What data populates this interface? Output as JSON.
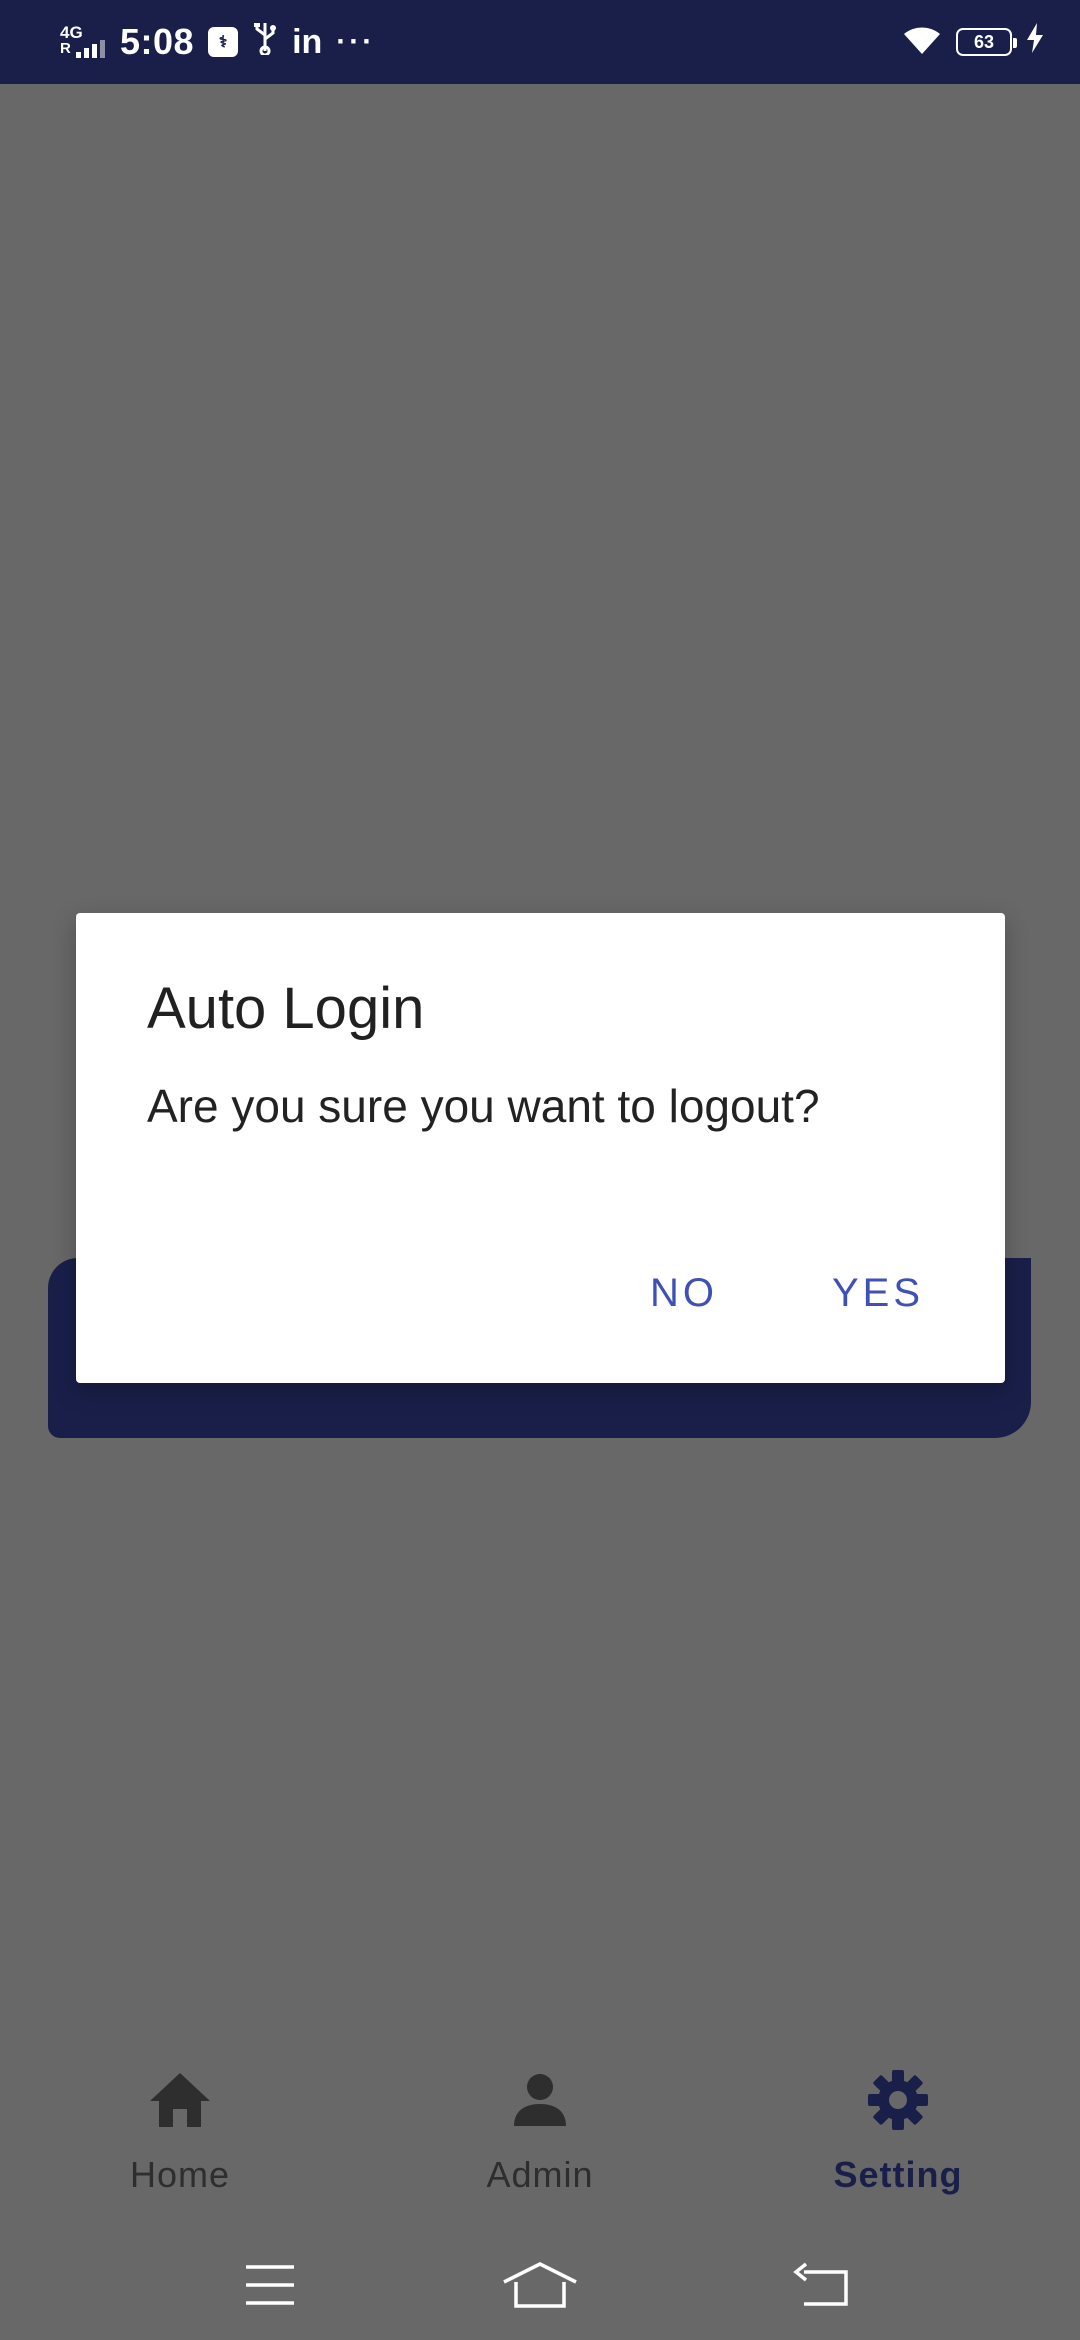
{
  "status_bar": {
    "network_top": "4G",
    "network_bottom": "R",
    "time": "5:08",
    "usb_debug_label": "⚕",
    "usb_icon": "usb-icon",
    "linkedin": "in",
    "more": "···",
    "battery_level": "63"
  },
  "dialog": {
    "title": "Auto Login",
    "message": "Are you sure you want to logout?",
    "no_label": "NO",
    "yes_label": "YES",
    "button_color": "#3f51b5"
  },
  "bottom_nav": {
    "items": [
      {
        "label": "Home",
        "icon": "home-icon",
        "active": false
      },
      {
        "label": "Admin",
        "icon": "person-icon",
        "active": false
      },
      {
        "label": "Setting",
        "icon": "gear-icon",
        "active": true
      }
    ],
    "active_color": "#1a1f4a"
  },
  "colors": {
    "status_bar": "#1a1f4a",
    "scrim_background": "#686868",
    "card": "#1a1f4a"
  }
}
